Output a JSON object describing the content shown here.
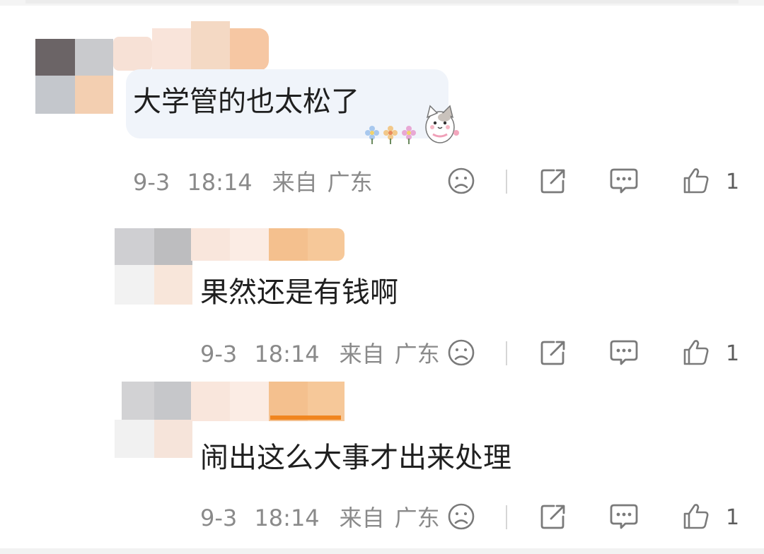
{
  "comments": [
    {
      "text": "大学管的也太松了",
      "date": "9-3",
      "time": "18:14",
      "source": "来自",
      "location": "广东",
      "likes": "1"
    },
    {
      "text": "果然还是有钱啊",
      "date": "9-3",
      "time": "18:14",
      "source": "来自",
      "location": "广东",
      "likes": "1"
    },
    {
      "text": "闹出这么大事才出来处理",
      "date": "9-3",
      "time": "18:14",
      "source": "来自",
      "location": "广东",
      "likes": "1"
    }
  ],
  "icons": {
    "dislike": "sad-face-icon",
    "share": "share-icon",
    "reply": "comment-bubble-icon",
    "like": "thumbs-up-icon"
  },
  "colors": {
    "text": "#1f1f1f",
    "meta": "#8a8a8a",
    "icon": "#7a7a7a",
    "bubble": "#f0f4fa"
  }
}
